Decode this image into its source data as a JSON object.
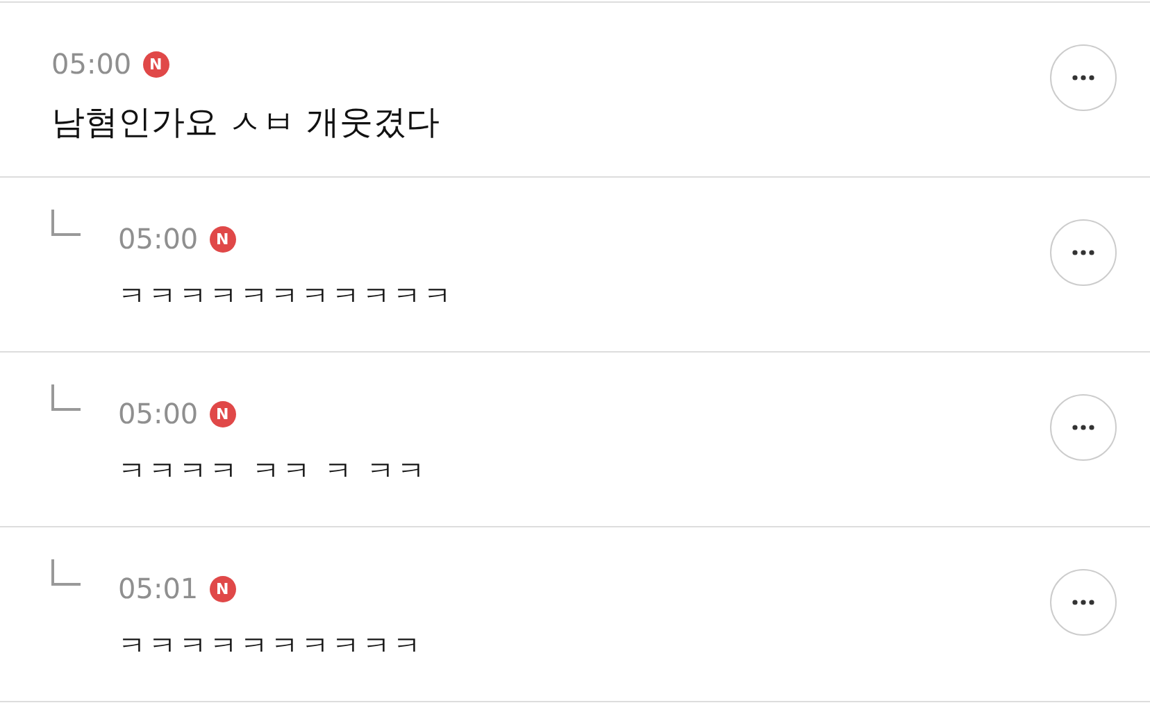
{
  "comments": [
    {
      "kind": "comment",
      "time": "05:00",
      "badge": "N",
      "text": "남혐인가요 ㅅㅂ 개웃겼다"
    },
    {
      "kind": "reply",
      "time": "05:00",
      "badge": "N",
      "text": "ㅋㅋㅋㅋㅋㅋㅋㅋㅋㅋㅋ"
    },
    {
      "kind": "reply",
      "time": "05:00",
      "badge": "N",
      "text": "ㅋㅋㅋㅋ ㅋㅋ ㅋ ㅋㅋ"
    },
    {
      "kind": "reply",
      "time": "05:01",
      "badge": "N",
      "text": "ㅋㅋㅋㅋㅋㅋㅋㅋㅋㅋ"
    }
  ]
}
